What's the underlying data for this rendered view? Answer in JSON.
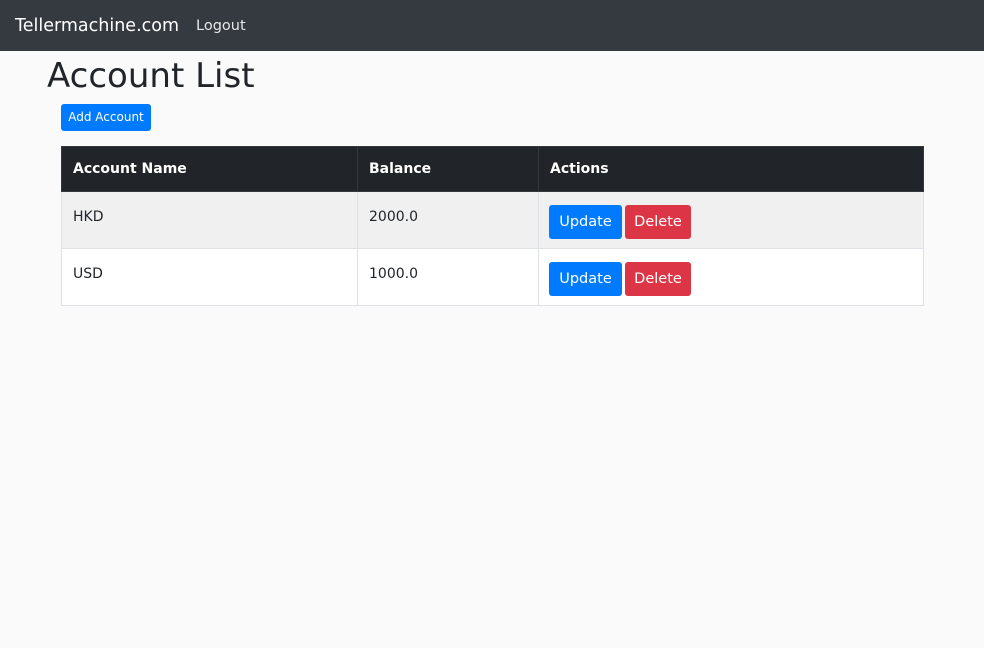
{
  "navbar": {
    "brand": "Tellermachine.com",
    "logout_label": "Logout",
    "background_color": "#343a40"
  },
  "page": {
    "title": "Account List",
    "add_button_label": "Add Account"
  },
  "table": {
    "headers": {
      "account_name": "Account Name",
      "balance": "Balance",
      "actions": "Actions"
    },
    "rows": [
      {
        "account_name": "HKD",
        "balance": "2000.0",
        "update_label": "Update",
        "delete_label": "Delete"
      },
      {
        "account_name": "USD",
        "balance": "1000.0",
        "update_label": "Update",
        "delete_label": "Delete"
      }
    ]
  },
  "colors": {
    "primary": "#007bff",
    "danger": "#dc3545",
    "table_header": "#212529"
  }
}
